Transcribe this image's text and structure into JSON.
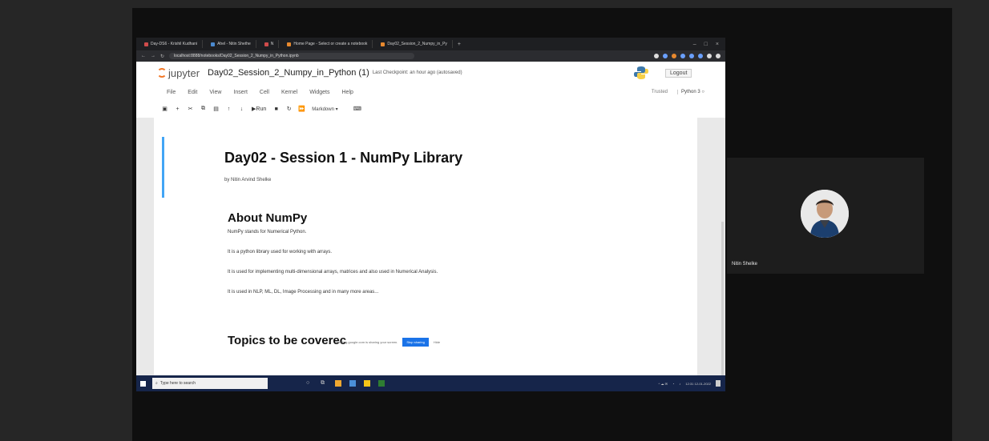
{
  "browser": {
    "tabs": [
      {
        "label": "Day-DS6 - Krishil Kudhani",
        "color": "#d04b4b"
      },
      {
        "label": "Ahel - Nitin Shethe",
        "color": "#4b8ad0"
      },
      {
        "label": "N",
        "color": "#d04b4b"
      },
      {
        "label": "Home Page - Select or create a notebook",
        "color": "#e8892e"
      },
      {
        "label": "Day02_Session_2_Numpy_in_Py",
        "color": "#e8892e"
      }
    ],
    "url": "localhost:8888/notebooks/Day02_Session_2_Numpy_in_Python.ipynb"
  },
  "jupyter": {
    "logo_text": "jupyter",
    "notebook_title": "Day02_Session_2_Numpy_in_Python",
    "title_suffix": "(1)",
    "checkpoint": "Last Checkpoint: an hour ago  (autosaved)",
    "logout": "Logout",
    "menu": [
      "File",
      "Edit",
      "View",
      "Insert",
      "Cell",
      "Kernel",
      "Widgets",
      "Help"
    ],
    "trusted": "Trusted",
    "kernel": "Python 3",
    "toolbar": {
      "run_label": "Run",
      "cell_type": "Markdown"
    }
  },
  "notebook": {
    "title": "Day02 - Session 1 - NumPy Library",
    "byline": "by Nitin Arvind Shelke",
    "section1_heading": "About NumPy",
    "paragraphs": [
      "NumPy stands for Numerical Python.",
      "It is a python library used for working with arrays.",
      "It is used for implementing multi-dimensional arrays, matrices and also used in Numerical Analysis.",
      "It is used in NLP, ML, DL, Image Processing and in many more areas..."
    ],
    "section2_heading": "Topics to be coverec",
    "notice": {
      "text": "meeting.google.com is sharing your screen.",
      "button": "Stop sharing",
      "close": "Hide"
    }
  },
  "taskbar": {
    "search_placeholder": "Type here to search",
    "time": "12:31",
    "date": "12-01-2022"
  },
  "meeting": {
    "participant_name": "Nitin Shelke"
  }
}
